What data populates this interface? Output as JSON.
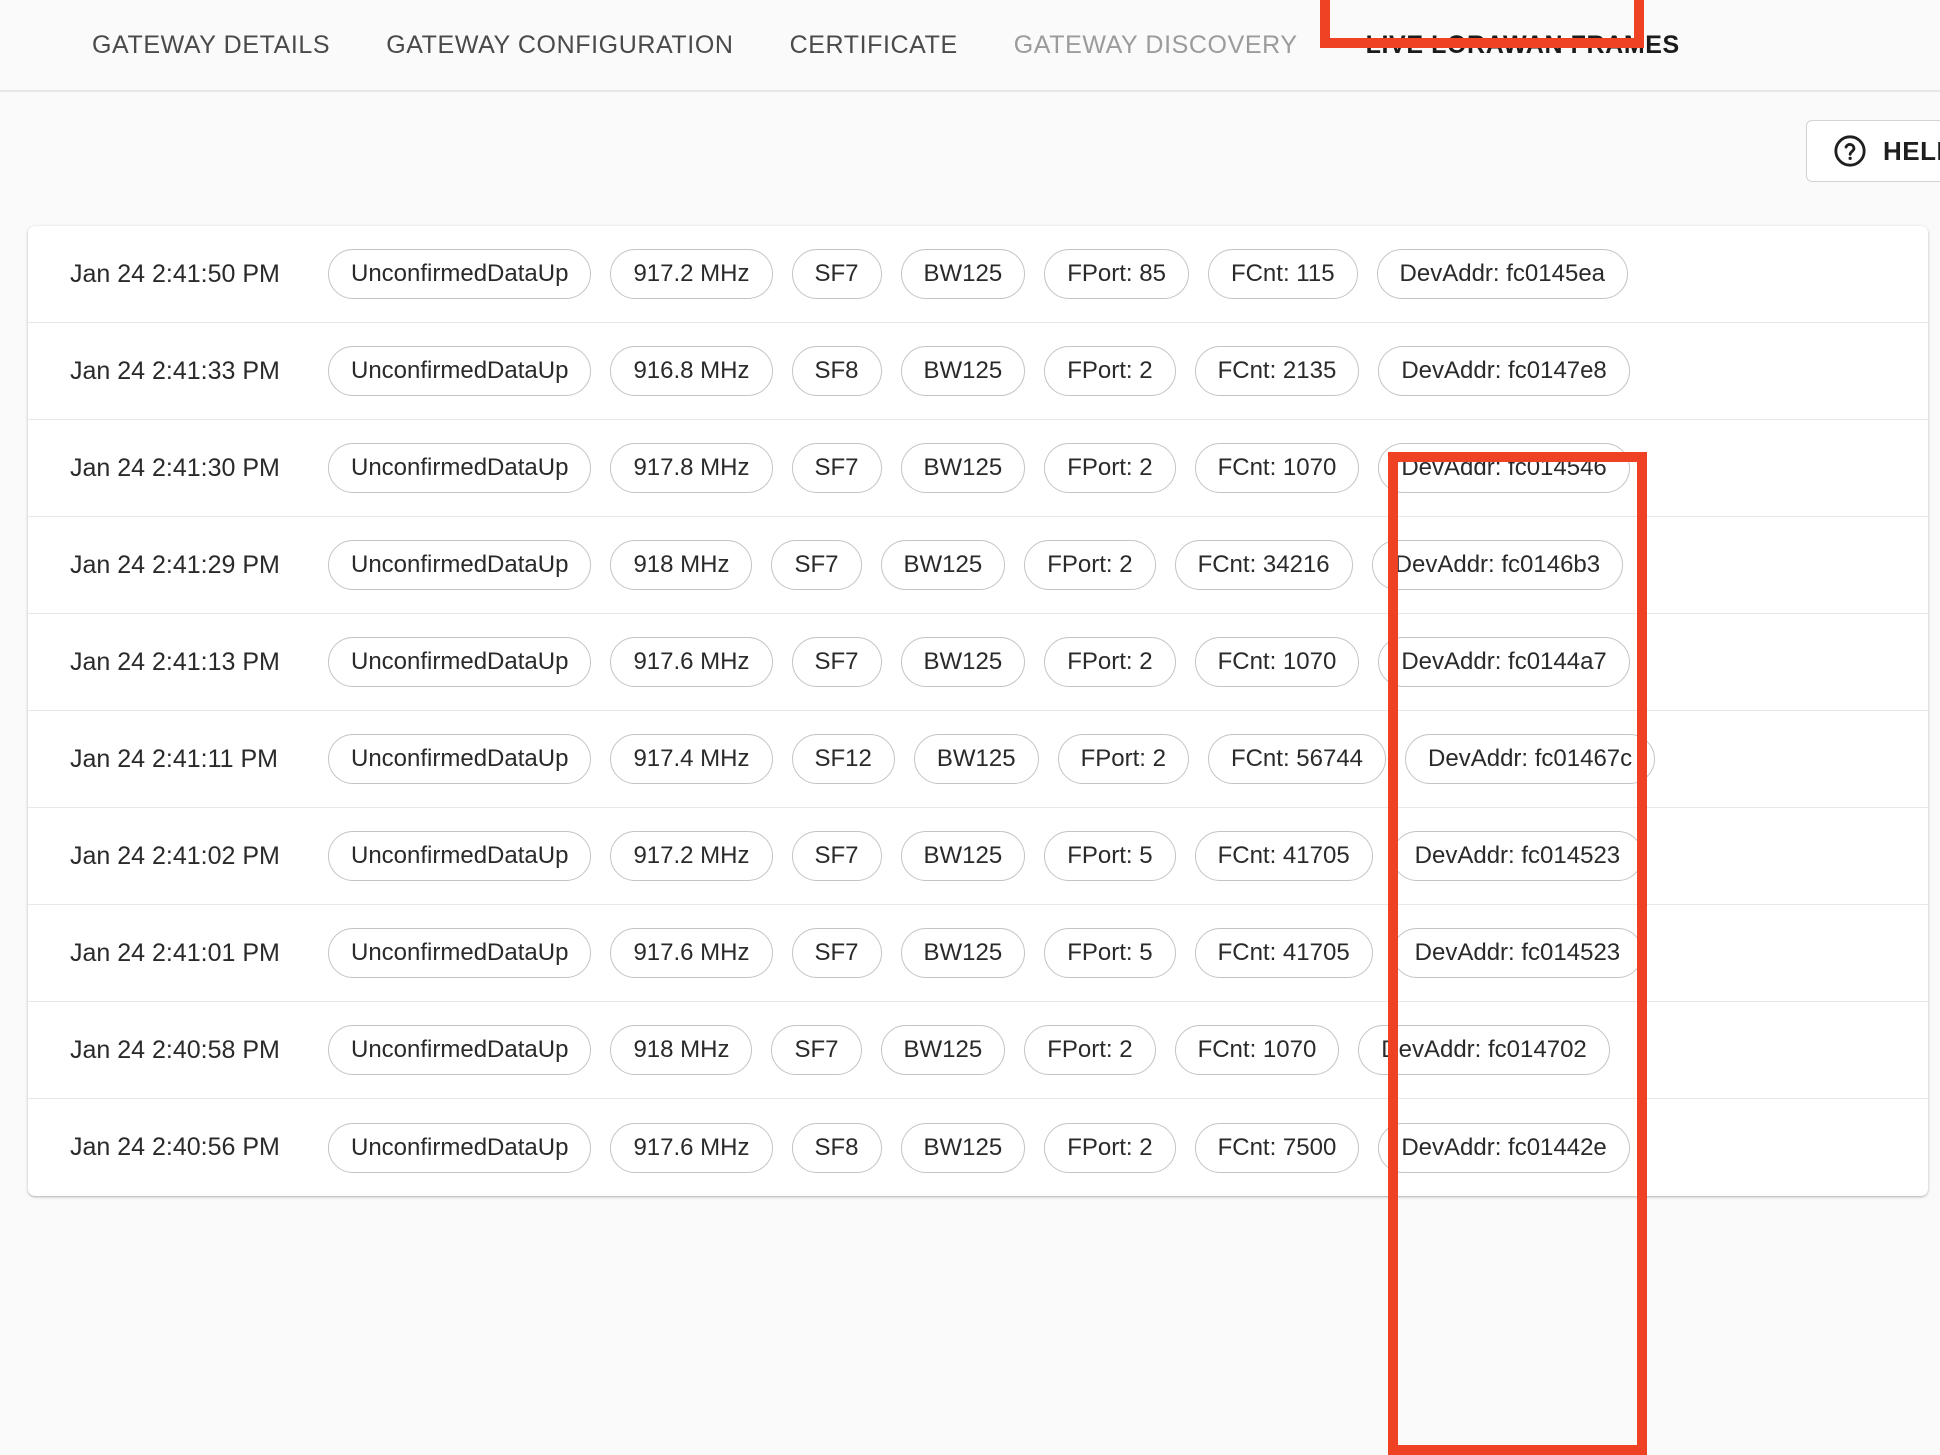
{
  "tabs": [
    {
      "label": "GATEWAY DETAILS",
      "state": "inactive"
    },
    {
      "label": "GATEWAY CONFIGURATION",
      "state": "inactive"
    },
    {
      "label": "CERTIFICATE",
      "state": "inactive"
    },
    {
      "label": "GATEWAY DISCOVERY",
      "state": "muted"
    },
    {
      "label": "LIVE LORAWAN FRAMES",
      "state": "active"
    }
  ],
  "toolbar": {
    "help_label": "HELP",
    "help_icon": "question-circle-icon"
  },
  "annotations": {
    "color": "#ef4123",
    "tab_target": "LIVE LORAWAN FRAMES",
    "column_target": "DevAddr"
  },
  "frames": [
    {
      "timestamp": "Jan 24 2:41:50 PM",
      "type": "UnconfirmedDataUp",
      "frequency": "917.2 MHz",
      "sf": "SF7",
      "bw": "BW125",
      "fport": "FPort: 85",
      "fcnt": "FCnt: 115",
      "devaddr": "DevAddr: fc0145ea"
    },
    {
      "timestamp": "Jan 24 2:41:33 PM",
      "type": "UnconfirmedDataUp",
      "frequency": "916.8 MHz",
      "sf": "SF8",
      "bw": "BW125",
      "fport": "FPort: 2",
      "fcnt": "FCnt: 2135",
      "devaddr": "DevAddr: fc0147e8"
    },
    {
      "timestamp": "Jan 24 2:41:30 PM",
      "type": "UnconfirmedDataUp",
      "frequency": "917.8 MHz",
      "sf": "SF7",
      "bw": "BW125",
      "fport": "FPort: 2",
      "fcnt": "FCnt: 1070",
      "devaddr": "DevAddr: fc014546"
    },
    {
      "timestamp": "Jan 24 2:41:29 PM",
      "type": "UnconfirmedDataUp",
      "frequency": "918 MHz",
      "sf": "SF7",
      "bw": "BW125",
      "fport": "FPort: 2",
      "fcnt": "FCnt: 34216",
      "devaddr": "DevAddr: fc0146b3"
    },
    {
      "timestamp": "Jan 24 2:41:13 PM",
      "type": "UnconfirmedDataUp",
      "frequency": "917.6 MHz",
      "sf": "SF7",
      "bw": "BW125",
      "fport": "FPort: 2",
      "fcnt": "FCnt: 1070",
      "devaddr": "DevAddr: fc0144a7"
    },
    {
      "timestamp": "Jan 24 2:41:11 PM",
      "type": "UnconfirmedDataUp",
      "frequency": "917.4 MHz",
      "sf": "SF12",
      "bw": "BW125",
      "fport": "FPort: 2",
      "fcnt": "FCnt: 56744",
      "devaddr": "DevAddr: fc01467c"
    },
    {
      "timestamp": "Jan 24 2:41:02 PM",
      "type": "UnconfirmedDataUp",
      "frequency": "917.2 MHz",
      "sf": "SF7",
      "bw": "BW125",
      "fport": "FPort: 5",
      "fcnt": "FCnt: 41705",
      "devaddr": "DevAddr: fc014523"
    },
    {
      "timestamp": "Jan 24 2:41:01 PM",
      "type": "UnconfirmedDataUp",
      "frequency": "917.6 MHz",
      "sf": "SF7",
      "bw": "BW125",
      "fport": "FPort: 5",
      "fcnt": "FCnt: 41705",
      "devaddr": "DevAddr: fc014523"
    },
    {
      "timestamp": "Jan 24 2:40:58 PM",
      "type": "UnconfirmedDataUp",
      "frequency": "918 MHz",
      "sf": "SF7",
      "bw": "BW125",
      "fport": "FPort: 2",
      "fcnt": "FCnt: 1070",
      "devaddr": "DevAddr: fc014702"
    },
    {
      "timestamp": "Jan 24 2:40:56 PM",
      "type": "UnconfirmedDataUp",
      "frequency": "917.6 MHz",
      "sf": "SF8",
      "bw": "BW125",
      "fport": "FPort: 2",
      "fcnt": "FCnt: 7500",
      "devaddr": "DevAddr: fc01442e"
    }
  ]
}
